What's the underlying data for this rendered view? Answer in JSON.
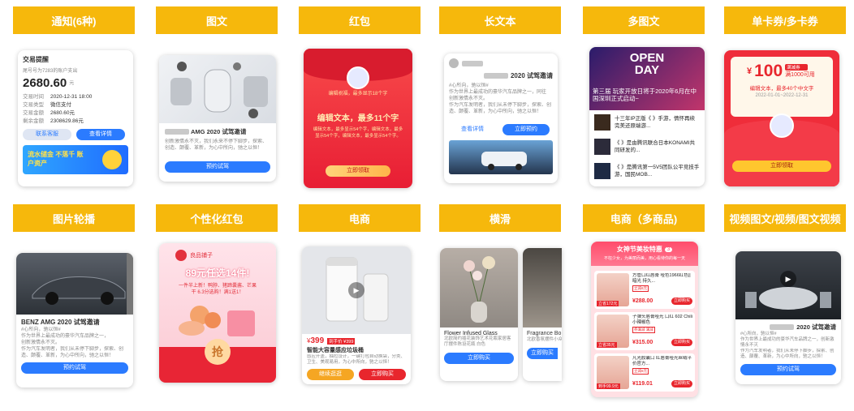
{
  "headers": [
    "通知(6种)",
    "图文",
    "红包",
    "长文本",
    "多图文",
    "单卡券/多卡券",
    "图片轮播",
    "个性化红包",
    "电商",
    "横滑",
    "电商（多商品)",
    "视频图文/视频/图文视频"
  ],
  "notice": {
    "title": "交易提醒",
    "desc": "尾号号为7283的账户支出",
    "amount": "2680.60",
    "unit": "元",
    "rows": [
      [
        "交易时间",
        "2020-12-31  18:00"
      ],
      [
        "交易类型",
        "微信支付"
      ],
      [
        "交易金额",
        "2680.60元"
      ],
      [
        "剩余金额",
        "2308629.86元"
      ]
    ],
    "btn1": "联系客服",
    "btn2": "查看详情",
    "banner": "流水储金 不落千 账户资产"
  },
  "tuwen": {
    "title": "AMG 2020 试驾邀请",
    "text": "创新激情永不灭，我们永来不停下脚步，探索、创造、颠覆、革新，为心中所向，驰之以恒！",
    "btn": "预约试驾"
  },
  "hongbao": {
    "sub": "编辑祝福，最多显示18个字",
    "title": "编辑文本，最多11个字",
    "body": "编辑文本，最多显示54个字，编辑文本，最多显示54个字，编辑文本，最多显示54个字。",
    "btn": "立即领取"
  },
  "longtext": {
    "title": "2020 试驾邀请",
    "l1": "#心所向，驰以恒#",
    "l2": "作为世界上最成功的豪华汽车品牌之一，同往",
    "l3": "创新激情永不灭。",
    "l4": "作为汽车发明者，我们从未停下脚步，探索、创造、颠覆、革新，为心中所向，驰之以恒！",
    "btn1": "查看详情",
    "btn2": "立即预约"
  },
  "multi": {
    "cover": "第三届    玩家开放日将于2020年6月在中国深圳正式启动~",
    "items": [
      "十三年IP正版《    》手游，情怀再续完美还原端游...",
      "《    》是由腾讯联合日本KONAMI共同研发的...",
      "《    》是腾讯第一5V5团队公平竞技手游，国民MOB..."
    ],
    "open": "OPEN DAY"
  },
  "coupon": {
    "yen": "¥",
    "amount": "100",
    "tag": "满减券",
    "cond": "满1000可用",
    "note": "编辑文本，最多40个中文字",
    "date": "2022-01-01~2022-12-31",
    "btn": "立即领取"
  },
  "carousel": {
    "title": "BENZ AMG 2020 试驾邀请",
    "l1": "#心所向，驰以恒#",
    "l2": "作为世界上最成功的豪华汽车品牌之一，",
    "l3": "创新激情永不灭。",
    "l4": "作为汽车发明者，我们从未停下脚步，探索、创造、颠覆、革新，为心中所向，驰之以恒！",
    "btn": "预约试驾"
  },
  "phb": {
    "brand": "良品铺子",
    "big": "89元任选14件!",
    "sub": "一件半上新！鸭脖、猪蹄囊酱、芒果干 6.3分选购！满1送1！",
    "grab": "抢"
  },
  "ecom": {
    "price": "399",
    "tag": "到手价 ¥399",
    "name": "智能大容量感应垃圾桶",
    "desc": "感应开盖，抽拉设计，一键打包自动换袋，分类、卫生、美观易用，为心中所向，驰之以恒！",
    "btn1": "继续逛逛",
    "btn2": "立即购买"
  },
  "slide": {
    "name": "Flower Infused Glass",
    "desc": "北欧简约插花装饰艺术花瓶家居客厅摆件陈设花瓶 白色",
    "name2": "Fragrance Bo",
    "desc2": "北欧香氛摆件小众设计感创意高级家居",
    "btn": "立即购买"
  },
  "multiecom": {
    "title": "女神节美妆特惠",
    "badge": "3",
    "sub": "不枉少女，为美丽而美，用心看待你的每一天",
    "items": [
      {
        "name": "方管口红唇膏 哑色1966红色||暗光 持久...",
        "tag": "立减6元",
        "coupon": "立省172元",
        "price": "¥288.00"
      },
      {
        "name": "子弹头唇膏哑光 口红 602 Chili小辣椒色",
        "tag": "券满减 满减",
        "coupon": "立省35元",
        "price": "¥315.00"
      },
      {
        "name": "凡光胶囊口 红唇膏哑光丝绒平价官方...",
        "tag": "立减6元",
        "coupon": "到手99.9元",
        "price": "¥119.01"
      }
    ],
    "btn": "立即购买"
  },
  "video": {
    "title": "2020 试驾邀请",
    "l1": "#心所向，驰以恒#",
    "l2": "作为世界上最成功的豪华汽车品牌之一，创新激情永不灭",
    "l3": "作为汽车发明者，我们从未停下脚步，探索、创造、颠覆、革新，为心中所向，驰之以恒！",
    "btn": "预约试驾"
  },
  "colors": {
    "header": "#f6b80c",
    "blue": "#2b7bff",
    "red": "#e8262d",
    "orange": "#f5a623"
  }
}
